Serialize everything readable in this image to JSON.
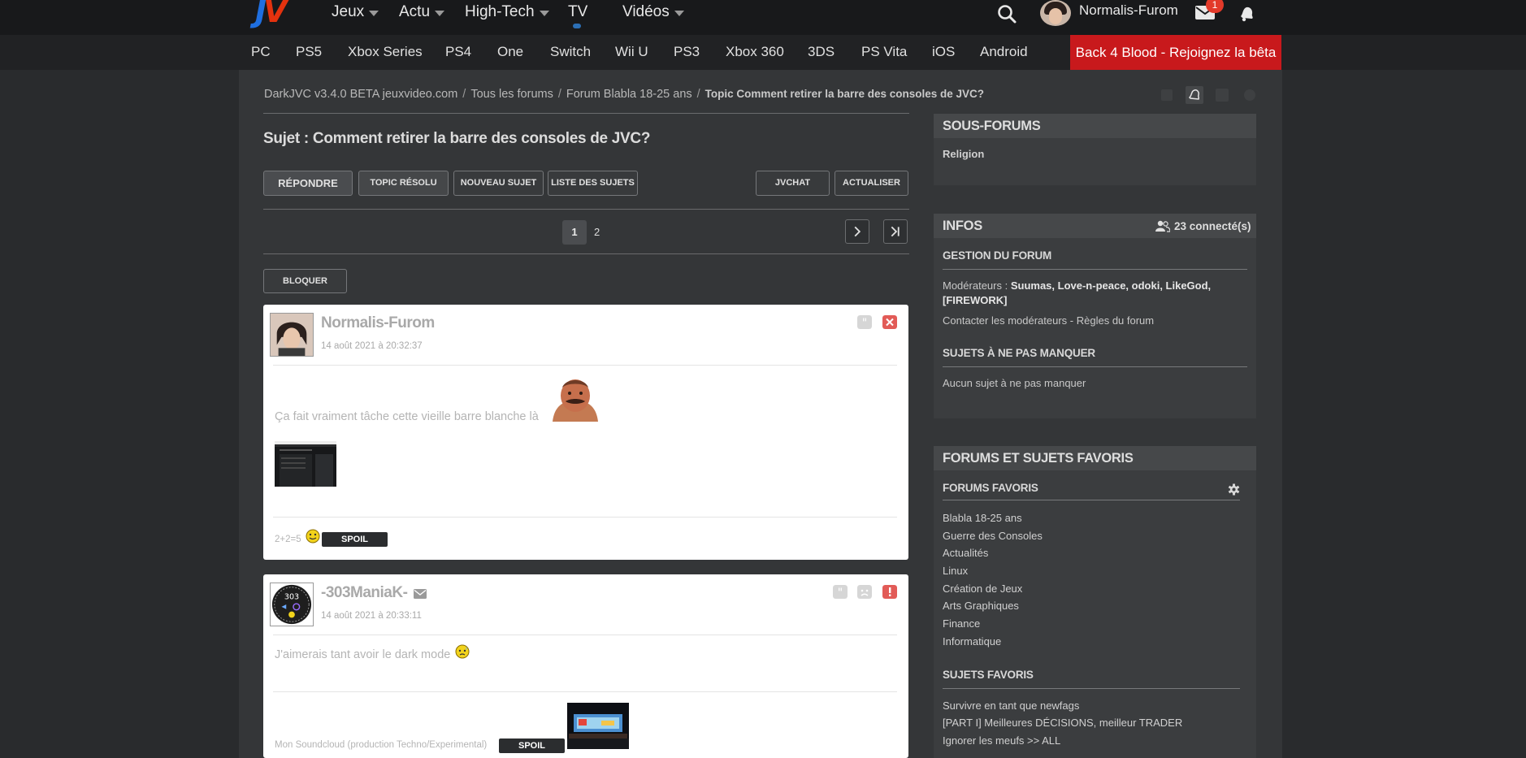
{
  "header": {
    "logo": "JV",
    "nav": [
      {
        "label": "Jeux",
        "dropdown": true
      },
      {
        "label": "Actu",
        "dropdown": true
      },
      {
        "label": "High-Tech",
        "dropdown": true
      },
      {
        "label": "TV",
        "dropdown": false
      },
      {
        "label": "Vidéos",
        "dropdown": true
      }
    ],
    "username": "Normalis-Furom",
    "mail_badge": "1",
    "icons": [
      "search-icon",
      "mail-icon",
      "bell-icon"
    ]
  },
  "consoles": [
    "PC",
    "PS5",
    "Xbox Series",
    "PS4",
    "One",
    "Switch",
    "Wii U",
    "PS3",
    "Xbox 360",
    "3DS",
    "PS Vita",
    "iOS",
    "Android"
  ],
  "promo": "Back 4 Blood - Rejoignez la bêta",
  "breadcrumb": {
    "ext": "DarkJVC v3.4.0 BETA",
    "site": "jeuxvideo.com",
    "items": [
      "Tous les forums",
      "Forum Blabla 18-25 ans",
      "Topic Comment retirer la barre des consoles de JVC?"
    ],
    "separator": "/"
  },
  "topic": {
    "title": "Sujet : Comment retirer la barre des consoles de JVC?"
  },
  "actions": {
    "reply": "Répondre",
    "resolved": "Topic résolu",
    "new_topic": "Nouveau sujet",
    "list": "Liste des sujets",
    "jvchat": "JVChat",
    "refresh": "Actualiser",
    "block": "Bloquer"
  },
  "pagination": {
    "current": "1",
    "next_page": "2"
  },
  "posts": [
    {
      "author": "Normalis-Furom",
      "date": "14 août 2021 à 20:32:37",
      "text": "Ça fait vraiment tâche cette vieille barre blanche là",
      "signature": "2+2=5",
      "spoil": "SPOIL"
    },
    {
      "author": "-303ManiaK-",
      "date": "14 août 2021 à 20:33:11",
      "avatar_text": "303",
      "text": "J'aimerais tant avoir le dark mode",
      "signature": "Mon Soundcloud (production Techno/Experimental)",
      "spoil": "SPOIL"
    }
  ],
  "sidebar": {
    "subforums": {
      "title": "Sous-forums",
      "items": [
        "Religion"
      ]
    },
    "infos": {
      "title": "Infos",
      "connected": "23 connecté(s)",
      "management_title": "Gestion du forum",
      "moderators_label": "Modérateurs :",
      "moderators": "Suumas, Love-n-peace, odoki, LikeGod,",
      "moderators_2": "[FIREWORK]",
      "contact": "Contacter les modérateurs - Règles du forum",
      "must_see_title": "Sujets à ne pas manquer",
      "must_see_text": "Aucun sujet à ne pas manquer"
    },
    "favorites": {
      "title": "Forums et sujets favoris",
      "forums_title": "Forums favoris",
      "forums": [
        "Blabla 18-25 ans",
        "Guerre des Consoles",
        "Actualités",
        "Linux",
        "Création de Jeux",
        "Arts Graphiques",
        "Finance",
        "Informatique"
      ],
      "topics_title": "Sujets favoris",
      "topics": [
        "Survivre en tant que newfags",
        "[PART I] Meilleures DÉCISIONS, meilleur TRADER",
        "Ignorer les meufs >> ALL"
      ]
    }
  },
  "colors": {
    "promo": "#c8191c",
    "logo_blue": "#1f6fe0",
    "logo_red": "#e4320e",
    "badge": "#e33a2a"
  }
}
